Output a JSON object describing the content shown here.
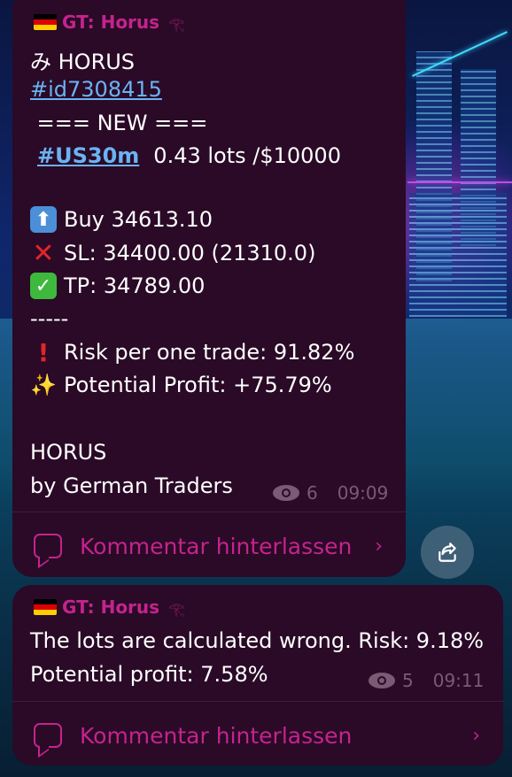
{
  "messages": [
    {
      "sender": "GT: Horus",
      "sender_suffix": "𓂀",
      "lines": {
        "title": "み HORUS",
        "id_tag": "#id7308415",
        "new_banner": " === NEW ===",
        "symbol_tag": "#US30m",
        "lots": "0.43 lots /$10000",
        "buy": "Buy 34613.10",
        "sl": "SL: 34400.00 (21310.0)",
        "tp": "TP: 34789.00",
        "separator": "-----",
        "risk": "Risk per one trade: 91.82%",
        "profit": "Potential Profit: +75.79%",
        "signature_1": "HORUS",
        "signature_2": "by German Traders"
      },
      "views": "6",
      "time": "09:09",
      "comment_label": "Kommentar hinterlassen",
      "chevron": "›"
    },
    {
      "sender": "GT: Horus",
      "sender_suffix": "𓂀",
      "lines": {
        "line_1": "The lots are calculated wrong. Risk: 9.18%",
        "line_2": "Potential profit: 7.58%"
      },
      "views": "5",
      "time": "09:11",
      "comment_label": "Kommentar hinterlassen",
      "chevron": "›"
    }
  ],
  "icons": {
    "flag": "germany-flag-icon",
    "buy": "up-arrow-icon",
    "sl": "cross-mark-icon",
    "tp": "check-mark-icon",
    "risk": "exclamation-icon",
    "profit": "sparkles-icon",
    "views": "eye-icon",
    "comment": "comment-icon",
    "share": "share-icon"
  },
  "colors": {
    "bubble": "#2a0a26",
    "accent": "#c4238e",
    "link": "#6ab3f3",
    "meta": "#7a5a74"
  }
}
